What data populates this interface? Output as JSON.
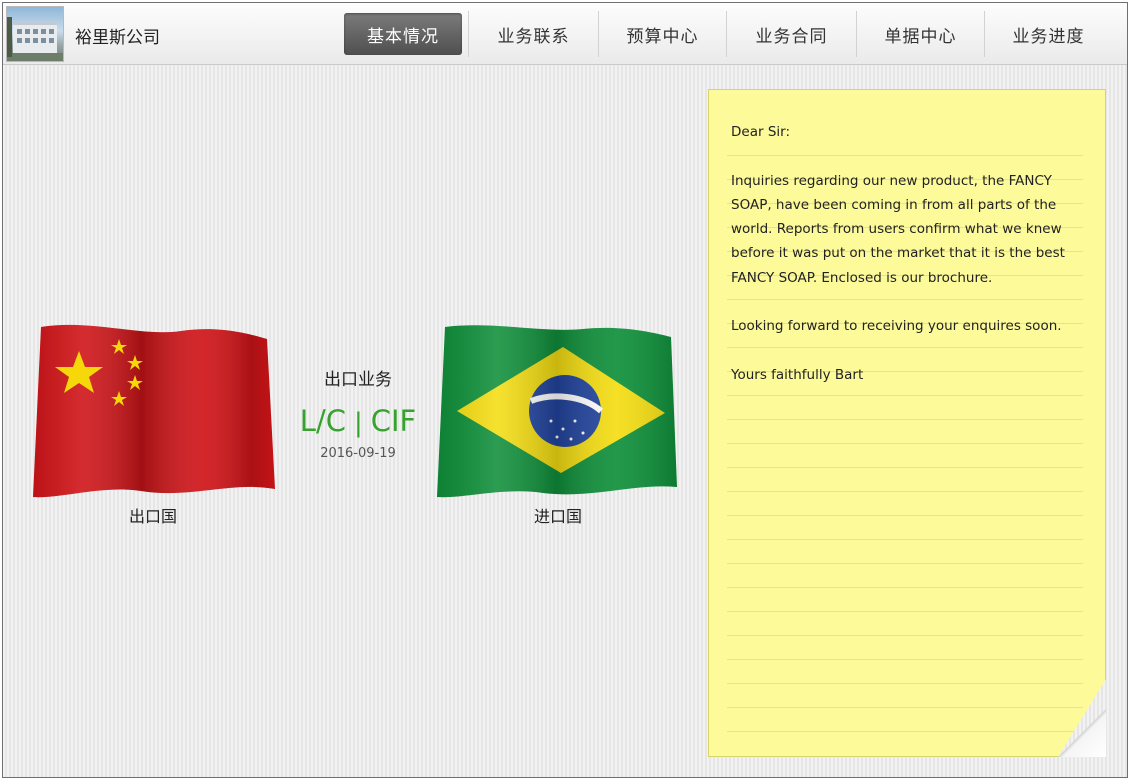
{
  "header": {
    "company_name": "裕里斯公司",
    "nav": [
      "基本情况",
      "业务联系",
      "预算中心",
      "业务合同",
      "单据中心",
      "业务进度"
    ],
    "active_tab": "基本情况"
  },
  "export_country": {
    "label": "出口国",
    "flag_icon": "china-flag"
  },
  "import_country": {
    "label": "进口国",
    "flag_icon": "brazil-flag"
  },
  "business": {
    "type": "出口业务",
    "payment": "L/C",
    "term": "CIF",
    "date": "2016-09-19"
  },
  "letter": {
    "greeting": "Dear Sir:",
    "body": "Inquiries regarding our new product, the FANCY SOAP, have been coming in from all parts of the world. Reports from users confirm what we knew before it was put on the market that it is the best FANCY SOAP. Enclosed is our brochure.",
    "closing_line": "Looking forward to receiving your enquires soon.",
    "signature": "Yours faithfully Bart"
  },
  "colors": {
    "accent_green": "#36a32f",
    "note_yellow": "#fdfa9a",
    "active_tab": "#5a5a5a"
  }
}
